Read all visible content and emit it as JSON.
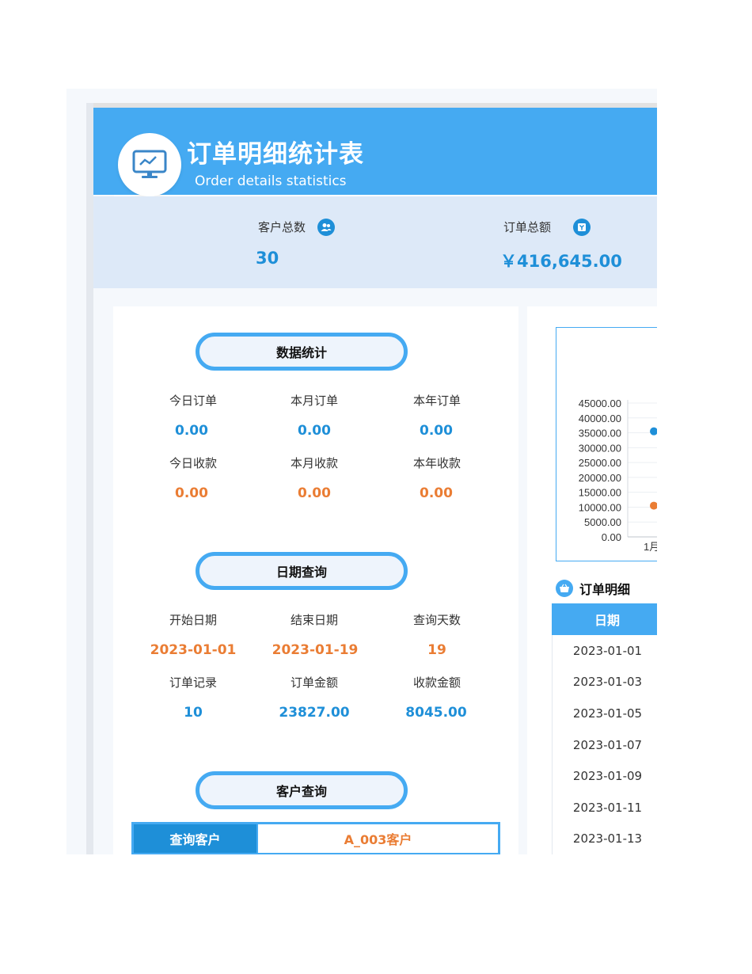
{
  "header": {
    "title": "订单明细统计表",
    "subtitle": "Order details statistics",
    "monitor_icon": "monitor-chart-icon"
  },
  "summary": {
    "customers_label": "客户总数",
    "customers_value": "30",
    "customers_icon": "users-icon",
    "amount_label": "订单总额",
    "amount_value": "￥416,645.00",
    "amount_icon": "wallet-icon"
  },
  "stats": {
    "title": "数据统计",
    "orders": [
      {
        "label": "今日订单",
        "value": "0.00"
      },
      {
        "label": "本月订单",
        "value": "0.00"
      },
      {
        "label": "本年订单",
        "value": "0.00"
      }
    ],
    "payments": [
      {
        "label": "今日收款",
        "value": "0.00"
      },
      {
        "label": "本月收款",
        "value": "0.00"
      },
      {
        "label": "本年收款",
        "value": "0.00"
      }
    ]
  },
  "date_query": {
    "title": "日期查询",
    "row1": [
      {
        "label": "开始日期",
        "value": "2023-01-01"
      },
      {
        "label": "结束日期",
        "value": "2023-01-19"
      },
      {
        "label": "查询天数",
        "value": "19"
      }
    ],
    "row2": [
      {
        "label": "订单记录",
        "value": "10"
      },
      {
        "label": "订单金额",
        "value": "23827.00"
      },
      {
        "label": "收款金额",
        "value": "8045.00"
      }
    ]
  },
  "customer_query": {
    "title": "客户查询",
    "label": "查询客户",
    "value": "A_003客户"
  },
  "chart_data": {
    "type": "scatter",
    "y_ticks": [
      "45000.00",
      "40000.00",
      "35000.00",
      "30000.00",
      "25000.00",
      "20000.00",
      "15000.00",
      "10000.00",
      "5000.00",
      "0.00"
    ],
    "ylim": [
      0,
      45000
    ],
    "x_ticks": [
      "1月"
    ],
    "series": [
      {
        "color": "#1e8fd8",
        "points": [
          {
            "x": "1月",
            "y": 35500
          }
        ]
      },
      {
        "color": "#ea7d34",
        "points": [
          {
            "x": "1月",
            "y": 10500
          }
        ]
      }
    ]
  },
  "order_detail": {
    "title": "订单明细",
    "icon": "basket-icon",
    "column_date": "日期",
    "dates": [
      "2023-01-01",
      "2023-01-03",
      "2023-01-05",
      "2023-01-07",
      "2023-01-09",
      "2023-01-11",
      "2023-01-13"
    ]
  }
}
